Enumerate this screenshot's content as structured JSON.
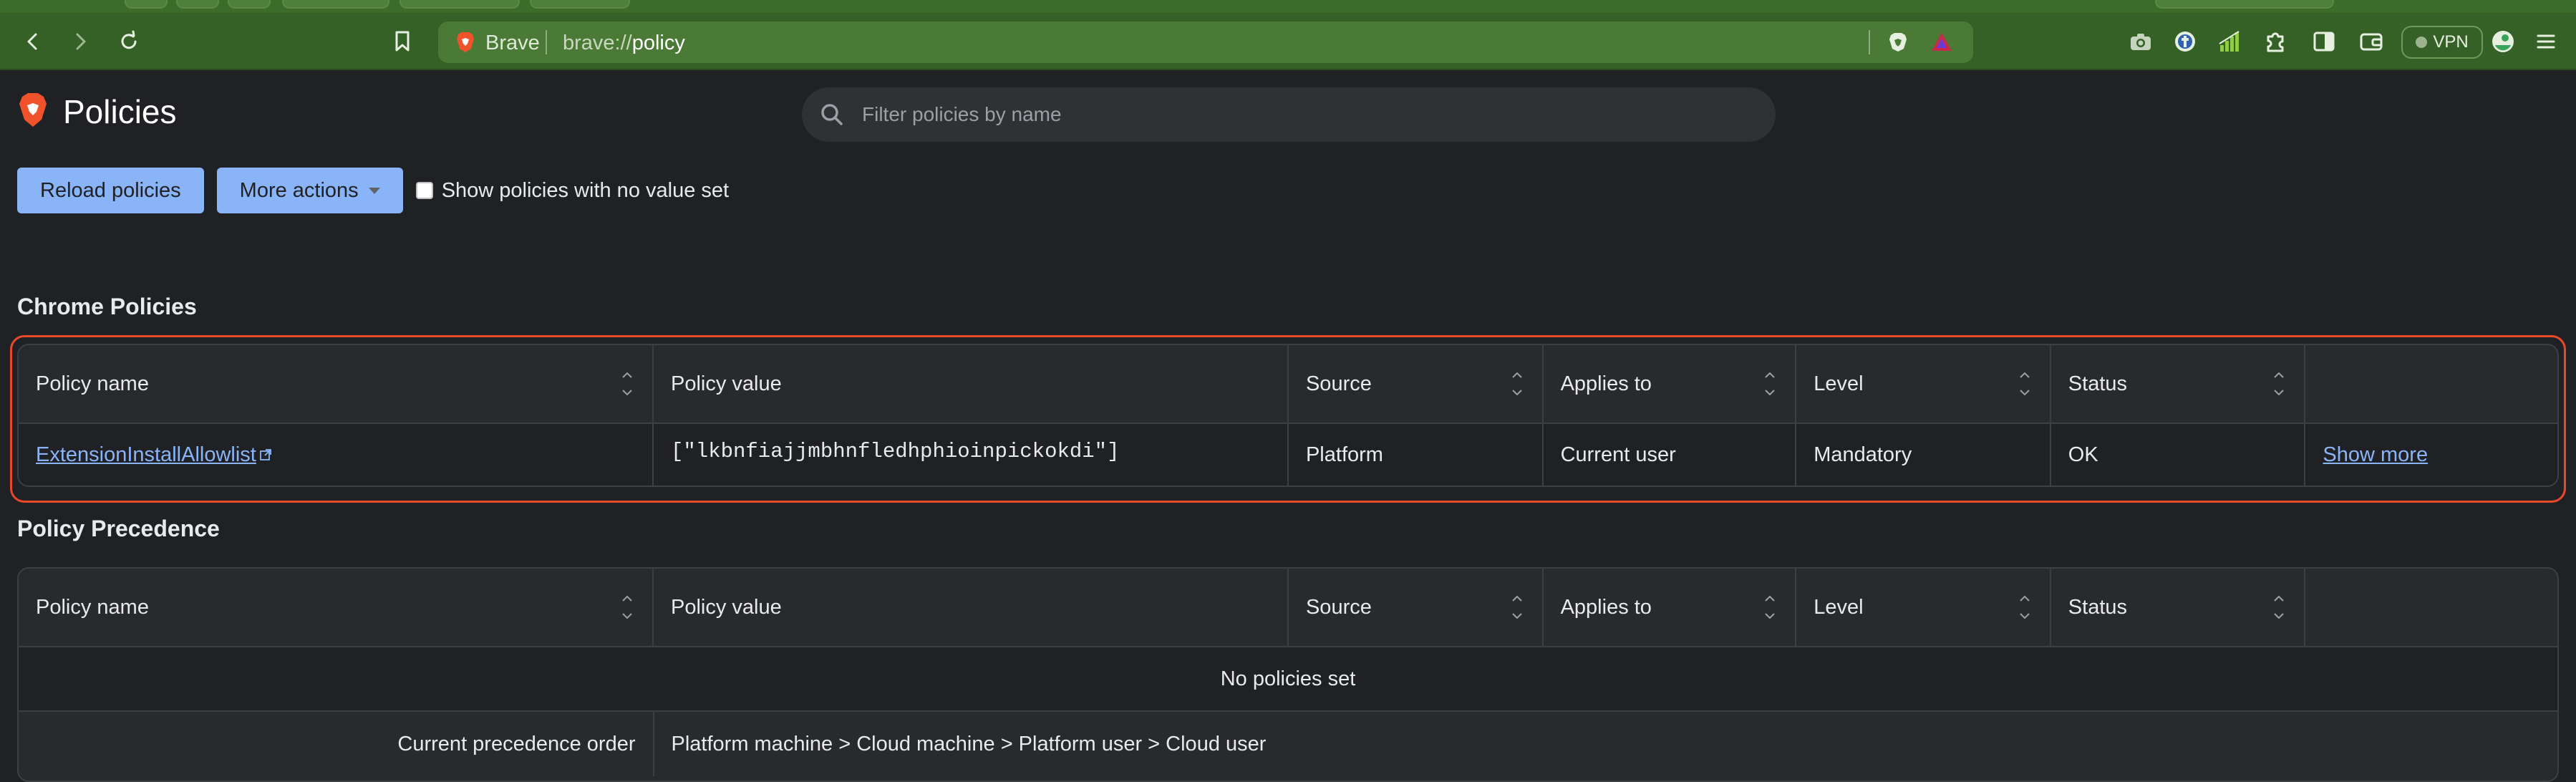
{
  "browser": {
    "brand": "Brave",
    "url_prefix": "brave://",
    "url_page": "policy",
    "vpn_label": "VPN"
  },
  "page": {
    "title": "Policies",
    "search_placeholder": "Filter policies by name",
    "reload_label": "Reload policies",
    "more_actions_label": "More actions",
    "show_unset_label": "Show policies with no value set"
  },
  "chrome_policies": {
    "title": "Chrome Policies",
    "headers": [
      "Policy name",
      "Policy value",
      "Source",
      "Applies to",
      "Level",
      "Status"
    ],
    "rows": [
      {
        "name": "ExtensionInstallAllowlist",
        "value": "[\"lkbnfiajjmbhnfledhphioinpickokdi\"]",
        "source": "Platform",
        "applies_to": "Current user",
        "level": "Mandatory",
        "status": "OK",
        "action": "Show more"
      }
    ]
  },
  "policy_precedence": {
    "title": "Policy Precedence",
    "headers": [
      "Policy name",
      "Policy value",
      "Source",
      "Applies to",
      "Level",
      "Status"
    ],
    "empty_message": "No policies set",
    "order_label": "Current precedence order",
    "order_value": "Platform machine > Cloud machine > Platform user > Cloud user"
  },
  "colors": {
    "toolbar": "#356026",
    "accent": "#8ab4f8",
    "highlight": "#e8492b",
    "page_bg": "#202124"
  }
}
